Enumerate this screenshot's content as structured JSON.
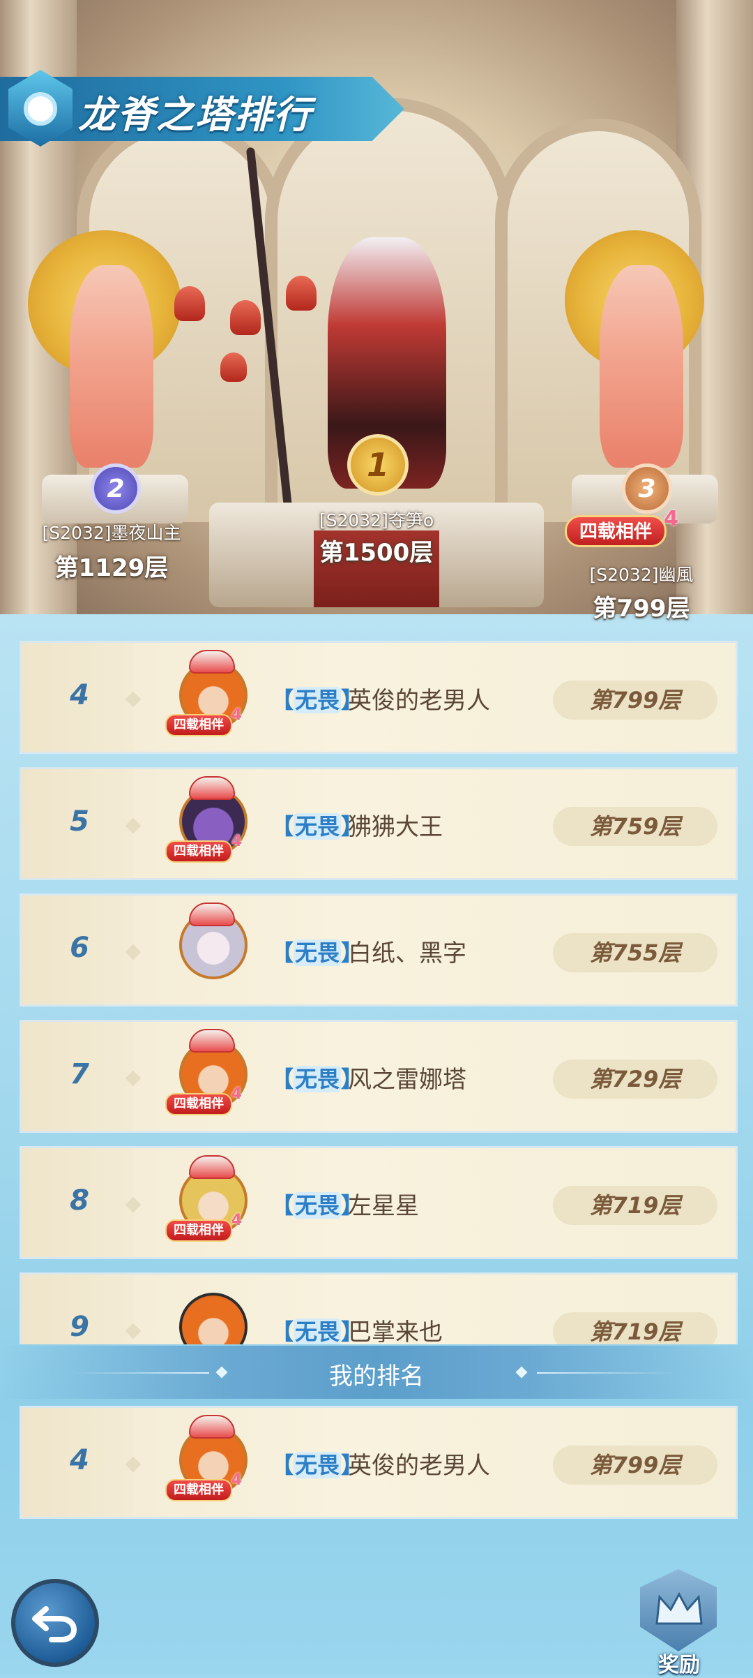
{
  "title": "龙脊之塔排行",
  "podium": [
    {
      "rank": "2",
      "name": "[S2032]墨夜山主",
      "floor": "第1129层"
    },
    {
      "rank": "1",
      "name": "[S2032]夺笋o",
      "floor": "第1500层"
    },
    {
      "rank": "3",
      "name": "[S2032]幽風",
      "floor": "第799层",
      "badge": "四载相伴",
      "badge_num": "4"
    }
  ],
  "list": [
    {
      "rank": "4",
      "guild": "无畏",
      "name": "英俊的老男人",
      "floor": "第799层",
      "badge": "四载相伴",
      "badge_num": "4",
      "avatar": "orange-hair-elf"
    },
    {
      "rank": "5",
      "guild": "无畏",
      "name": "狒狒大王",
      "floor": "第759层",
      "badge": "四载相伴",
      "badge_num": "4",
      "avatar": "purple-beast"
    },
    {
      "rank": "6",
      "guild": "无畏",
      "name": "白纸、黑字",
      "floor": "第755层",
      "avatar": "white-hair-girl"
    },
    {
      "rank": "7",
      "guild": "无畏",
      "name": "风之雷娜塔",
      "floor": "第729层",
      "badge": "四载相伴",
      "badge_num": "4",
      "avatar": "orange-hair-elf"
    },
    {
      "rank": "8",
      "guild": "无畏",
      "name": "左星星",
      "floor": "第719层",
      "badge": "四载相伴",
      "badge_num": "4",
      "avatar": "blonde-hero"
    },
    {
      "rank": "9",
      "guild": "无畏",
      "name": "巴掌来也",
      "floor": "第719层",
      "avatar": "orange-hair-elf"
    }
  ],
  "my_rank": {
    "header": "我的排名",
    "rank": "4",
    "guild": "无畏",
    "name": "英俊的老男人",
    "floor": "第799层",
    "badge": "四载相伴",
    "badge_num": "4"
  },
  "buttons": {
    "back_icon": "undo-arrow-icon",
    "reward_label": "奖励",
    "reward_icon": "crown-shield-icon"
  },
  "colors": {
    "rank_blue": "#3a74a6",
    "guild_blue": "#2c7fc6",
    "row_bg": "#f8f2de",
    "badge_red": "#c21d1d"
  }
}
